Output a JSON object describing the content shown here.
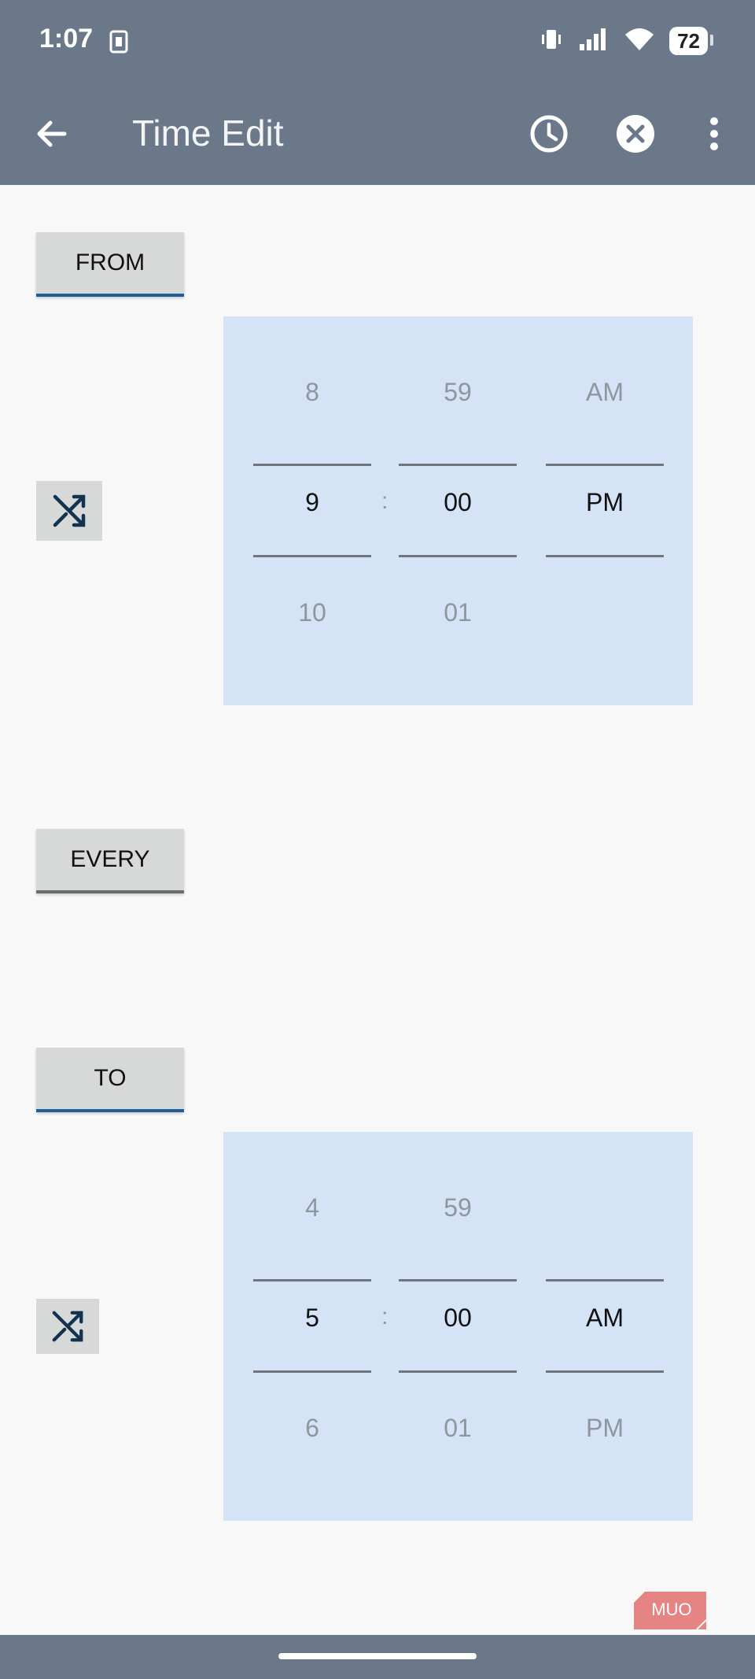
{
  "status_bar": {
    "time": "1:07",
    "battery": "72",
    "icons": [
      "notification-icon",
      "vibrate-icon",
      "signal-icon",
      "wifi-icon",
      "battery-icon"
    ]
  },
  "app_bar": {
    "title": "Time Edit",
    "icons": [
      "back-arrow-icon",
      "clock-icon",
      "clear-icon",
      "more-vert-icon"
    ]
  },
  "from": {
    "label": "FROM",
    "hour": {
      "prev": "8",
      "current": "9",
      "next": "10"
    },
    "separator": ":",
    "minute": {
      "prev": "59",
      "current": "00",
      "next": "01"
    },
    "ampm": {
      "prev": "AM",
      "current": "PM",
      "next": ""
    }
  },
  "every": {
    "label": "EVERY"
  },
  "to": {
    "label": "TO",
    "hour": {
      "prev": "4",
      "current": "5",
      "next": "6"
    },
    "separator": ":",
    "minute": {
      "prev": "59",
      "current": "00",
      "next": "01"
    },
    "ampm": {
      "prev": "",
      "current": "AM",
      "next": "PM"
    }
  },
  "watermark": "MUO",
  "colors": {
    "bar": "#6a7889",
    "picker_bg": "#d5e3f6",
    "button_bg": "#d7d8d8",
    "accent_underline": "#1f5f99",
    "shuffle_icon": "#12334f"
  }
}
